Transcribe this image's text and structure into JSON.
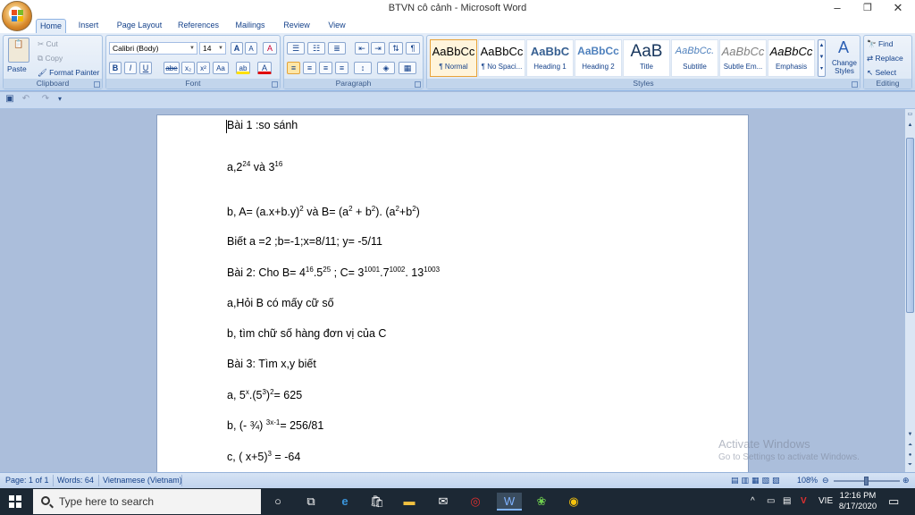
{
  "window": {
    "title": "BTVN cô cảnh - Microsoft Word",
    "minimize": "–",
    "maximize": "❐",
    "close": "✕"
  },
  "qat_top": "💾 ↶ ↷ ▾",
  "tabs": [
    {
      "label": "Home"
    },
    {
      "label": "Insert"
    },
    {
      "label": "Page Layout"
    },
    {
      "label": "References"
    },
    {
      "label": "Mailings"
    },
    {
      "label": "Review"
    },
    {
      "label": "View"
    }
  ],
  "clipboard": {
    "paste": "Paste",
    "cut": "Cut",
    "copy": "Copy",
    "format_painter": "Format Painter",
    "label": "Clipboard"
  },
  "font": {
    "family": "Calibri (Body)",
    "size": "14",
    "grow": "A",
    "shrink": "A",
    "clear": "A",
    "bold": "B",
    "italic": "I",
    "underline": "U",
    "strike": "abe",
    "subscript": "x₂",
    "superscript": "x²",
    "change_case": "Aa",
    "highlight": "ab",
    "font_color": "A",
    "label": "Font"
  },
  "paragraph": {
    "label": "Paragraph"
  },
  "styles": {
    "label": "Styles",
    "items": [
      {
        "sample": "AaBbCc",
        "name": "¶ Normal"
      },
      {
        "sample": "AaBbCc",
        "name": "¶ No Spaci..."
      },
      {
        "sample": "AaBbC",
        "name": "Heading 1"
      },
      {
        "sample": "AaBbCc",
        "name": "Heading 2"
      },
      {
        "sample": "AaB",
        "name": "Title"
      },
      {
        "sample": "AaBbCc.",
        "name": "Subtitle"
      },
      {
        "sample": "AaBbCc",
        "name": "Subtle Em..."
      },
      {
        "sample": "AaBbCc",
        "name": "Emphasis"
      }
    ],
    "change_styles": "Change Styles"
  },
  "editing": {
    "label": "Editing",
    "find": "Find",
    "replace": "Replace",
    "select": "Select"
  },
  "document": {
    "lines": {
      "l1": "Bài 1 :so sánh",
      "l2a": "a,2",
      "l2b": "24",
      "l2c": " và 3",
      "l2d": "16",
      "l3a": "b, A= (a.x+b.y)",
      "l3b": "2",
      "l3c": " và B= (a",
      "l3d": "2",
      "l3e": " + b",
      "l3f": "2",
      "l3g": "). (a",
      "l3h": "2",
      "l3i": "+b",
      "l3j": "2",
      "l3k": ")",
      "l4": "Biết a =2 ;b=-1;x=8/11; y= -5/11",
      "l5a": "Bài 2: Cho B= 4",
      "l5b": "16",
      "l5c": ".5",
      "l5d": "25",
      "l5e": " ; C= 3",
      "l5f": "1001",
      "l5g": ".7",
      "l5h": "1002",
      "l5i": ". 13",
      "l5j": "1003",
      "l6": "a,Hỏi B có mấy cữ số",
      "l7": "b, tìm chữ số hàng đơn vị của C",
      "l8": "Bài 3: Tìm x,y biết",
      "l9a": "a, 5",
      "l9b": "x",
      "l9c": ".(5",
      "l9d": "3",
      "l9e": ")",
      "l9f": "2",
      "l9g": "= 625",
      "l10a": "b, (- ¾) ",
      "l10b": "3x-1",
      "l10c": "= 256/81",
      "l11a": "c, ( x+5)",
      "l11b": "3",
      "l11c": " = -64"
    }
  },
  "watermark": {
    "line1": "Activate Windows",
    "line2": "Go to Settings to activate Windows."
  },
  "status": {
    "page": "Page: 1 of 1",
    "words": "Words: 64",
    "language": "Vietnamese (Vietnam)",
    "zoom": "108%"
  },
  "taskbar": {
    "search_placeholder": "Type here to search",
    "time": "12:16 PM",
    "date": "8/17/2020",
    "lang": "VIE"
  }
}
